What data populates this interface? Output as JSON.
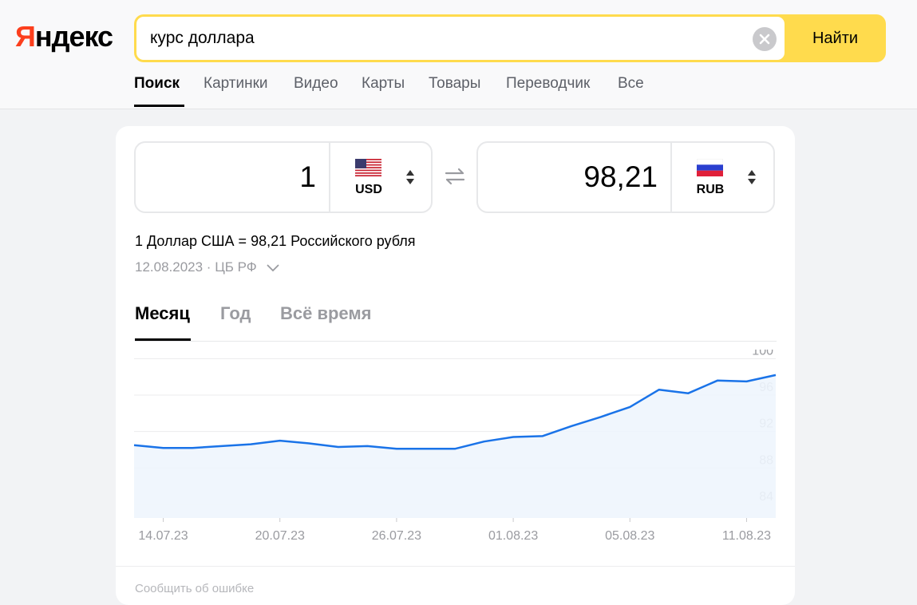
{
  "brand": {
    "logo_first": "Я",
    "logo_rest": "ндекс",
    "accent": "#fc3f1d",
    "search_accent": "#ffdb4d"
  },
  "search": {
    "query": "курс доллара",
    "button": "Найти",
    "clear_icon": "close-icon"
  },
  "tabs": [
    {
      "label": "Поиск",
      "active": true
    },
    {
      "label": "Картинки"
    },
    {
      "label": "Видео"
    },
    {
      "label": "Карты"
    },
    {
      "label": "Товары"
    },
    {
      "label": "Переводчик"
    },
    {
      "label": "Все"
    }
  ],
  "converter": {
    "from": {
      "amount": "1",
      "code": "USD",
      "flag_icon": "us-flag-icon"
    },
    "to": {
      "amount": "98,21",
      "code": "RUB",
      "flag_icon": "ru-flag-icon"
    },
    "rate_text": "1 Доллар США = 98,21 Российского рубля",
    "date_source": "12.08.2023 · ЦБ РФ"
  },
  "period_tabs": [
    {
      "label": "Месяц",
      "active": true
    },
    {
      "label": "Год"
    },
    {
      "label": "Всё время"
    }
  ],
  "chart_data": {
    "type": "area",
    "y_ticks": [
      "100",
      "96",
      "92",
      "88",
      "84"
    ],
    "ylim": [
      82.5,
      101
    ],
    "x_tick_labels": [
      "14.07.23",
      "20.07.23",
      "26.07.23",
      "01.08.23",
      "05.08.23",
      "11.08.23"
    ],
    "x": [
      "13.07.23",
      "14.07.23",
      "17.07.23",
      "18.07.23",
      "19.07.23",
      "20.07.23",
      "21.07.23",
      "22.07.23",
      "25.07.23",
      "26.07.23",
      "27.07.23",
      "28.07.23",
      "29.07.23",
      "01.08.23",
      "02.08.23",
      "03.08.23",
      "04.08.23",
      "05.08.23",
      "08.08.23",
      "09.08.23",
      "10.08.23",
      "11.08.23",
      "12.08.23"
    ],
    "values": [
      90.5,
      90.2,
      90.2,
      90.4,
      90.6,
      91.0,
      90.7,
      90.3,
      90.4,
      90.1,
      90.1,
      90.1,
      90.9,
      91.4,
      91.5,
      92.6,
      93.6,
      94.7,
      96.6,
      96.2,
      97.6,
      97.5,
      98.2
    ],
    "line_color": "#1a73e8",
    "grid": true
  },
  "footer": {
    "report_text": "Сообщить об ошибке"
  }
}
